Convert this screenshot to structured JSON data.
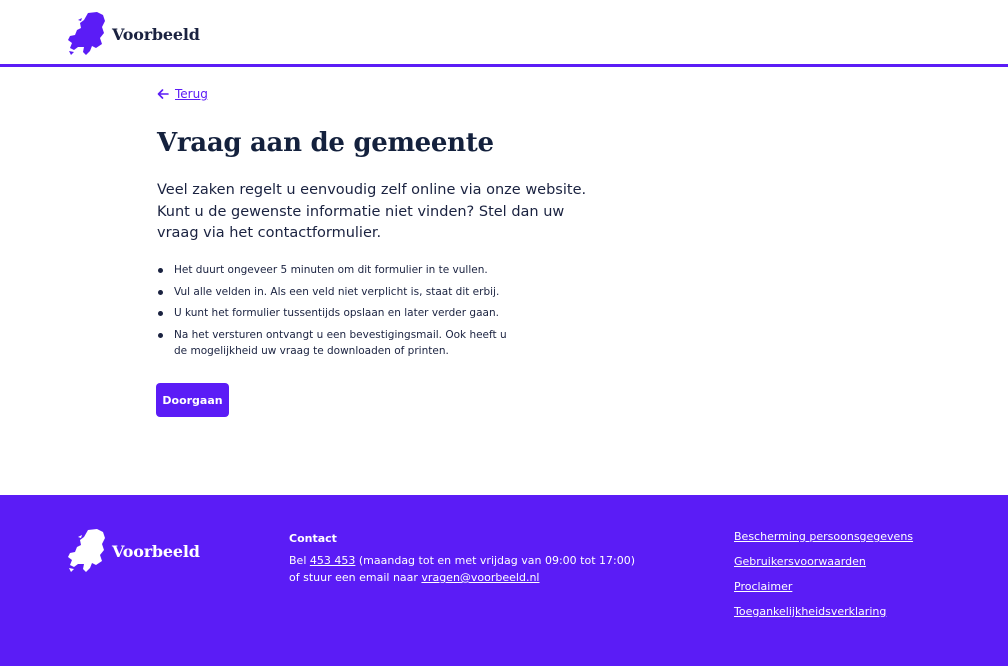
{
  "brand": {
    "name": "Voorbeeld",
    "accent": "#5b1cf6",
    "text_color": "#1a2240"
  },
  "header": {
    "logo_text": "Voorbeeld"
  },
  "back": {
    "label": "Terug",
    "icon": "arrow-left-icon"
  },
  "main": {
    "title": "Vraag aan de gemeente",
    "intro": "Veel zaken regelt u eenvoudig zelf online via onze website. Kunt u de gewenste informatie niet vinden? Stel dan uw vraag via het contactformulier.",
    "bullets": [
      "Het duurt ongeveer 5 minuten om dit formulier in te vullen.",
      "Vul alle velden in. Als een veld niet verplicht is, staat dit erbij.",
      "U kunt het formulier tussentijds opslaan en later verder gaan.",
      "Na het versturen ontvangt u een bevestigingsmail. Ook heeft u de mogelijkheid uw vraag te downloaden of printen."
    ],
    "continue_label": "Doorgaan"
  },
  "footer": {
    "logo_text": "Voorbeeld",
    "contact_heading": "Contact",
    "phone_prefix": "Bel ",
    "phone": "453 453",
    "phone_hours": " (maandag tot en met vrijdag van 09:00 tot 17:00)",
    "email_prefix": "of stuur een email naar ",
    "email": "vragen@voorbeeld.nl",
    "links": [
      "Bescherming persoonsgegevens",
      "Gebruikersvoorwaarden",
      "Proclaimer",
      "Toegankelijkheidsverklaring"
    ]
  }
}
